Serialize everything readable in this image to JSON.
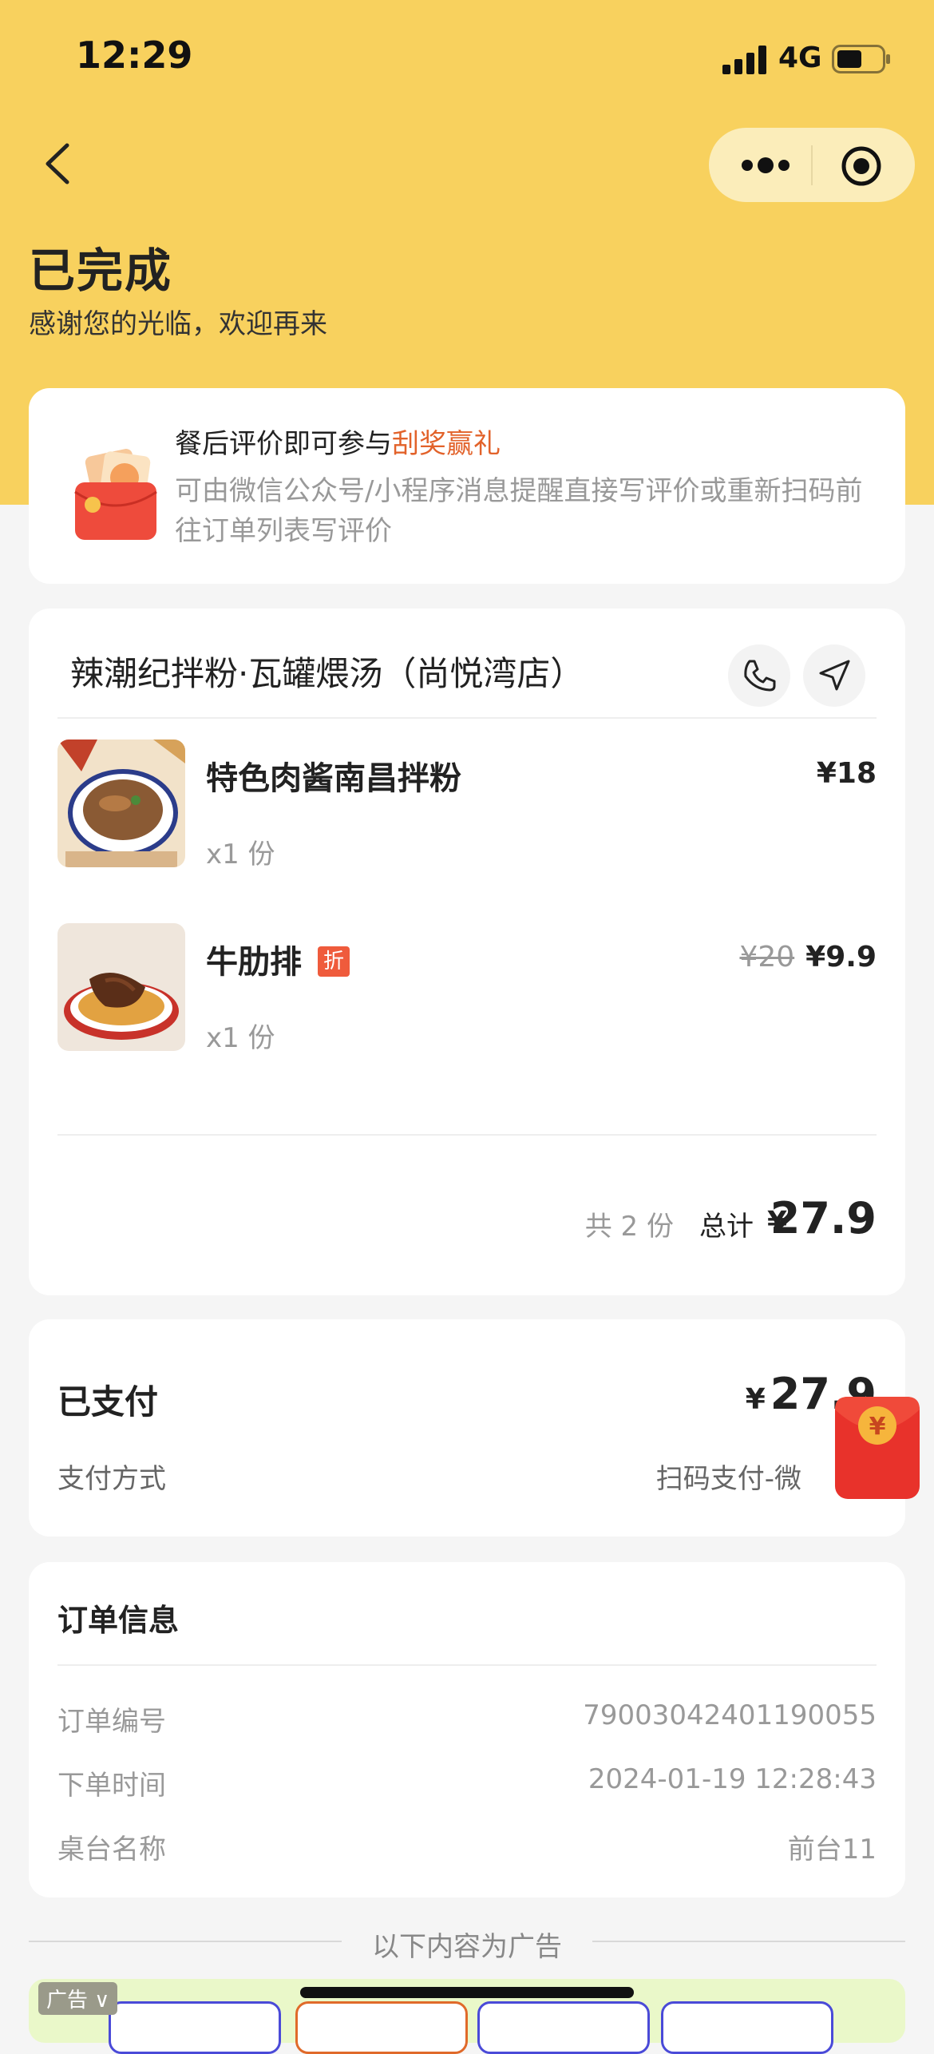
{
  "status_bar": {
    "time": "12:29",
    "network": "4G"
  },
  "nav": {
    "back_icon": "chevron-left-icon",
    "more_icon": "more-dots-icon",
    "close_icon": "target-close-icon"
  },
  "order_status": {
    "title": "已完成",
    "subtitle": "感谢您的光临，欢迎再来"
  },
  "promo": {
    "title_prefix": "餐后评价即可参与",
    "title_highlight": "刮奖赢礼",
    "description": "可由微信公众号/小程序消息提醒直接写评价或重新扫码前往订单列表写评价",
    "icon": "coupon-envelope-icon",
    "highlight_color": "#e2622a"
  },
  "shop": {
    "name": "辣潮纪拌粉·瓦罐煨汤（尚悦湾店）",
    "phone_icon": "phone-icon",
    "nav_icon": "navigate-icon"
  },
  "items": [
    {
      "name": "特色肉酱南昌拌粉",
      "qty": "x1 份",
      "price": "¥18"
    },
    {
      "name": "牛肋排",
      "tag": "折",
      "qty": "x1 份",
      "original_price": "¥20",
      "price": "¥9.9"
    }
  ],
  "summary": {
    "count": "共 2 份",
    "total_label": "总计",
    "yen": "¥",
    "total": "27.9"
  },
  "payment": {
    "label": "已支付",
    "yen": "¥",
    "amount": "27.9",
    "method_label": "支付方式",
    "method_value": "扫码支付-微"
  },
  "order_info": {
    "title": "订单信息",
    "rows": [
      {
        "label": "订单编号",
        "value": "79003042401190055"
      },
      {
        "label": "下单时间",
        "value": "2024-01-19 12:28:43"
      },
      {
        "label": "桌台名称",
        "value": "前台11"
      }
    ]
  },
  "ad": {
    "divider_text": "以下内容为广告",
    "badge": "广告 ∨"
  },
  "colors": {
    "header": "#f8d15e",
    "accent": "#e2622a",
    "tag": "#ef5b3c"
  }
}
